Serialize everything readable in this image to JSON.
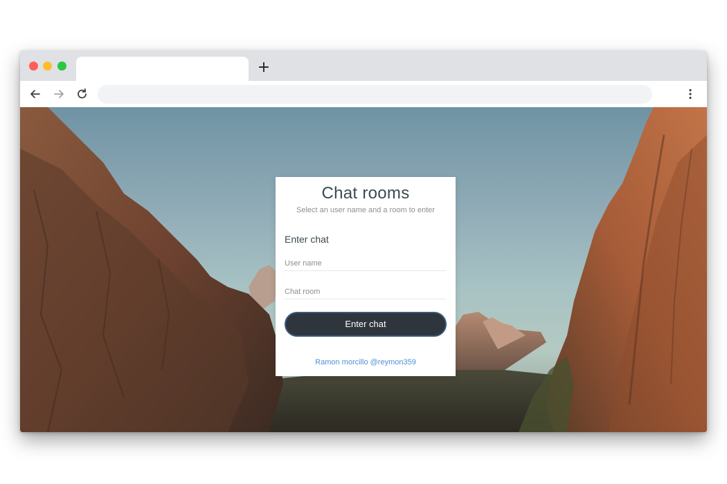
{
  "browser": {
    "new_tab_label": "+",
    "colors": {
      "close": "#ff5f57",
      "minimize": "#febc2e",
      "maximize": "#28c840",
      "tab_strip": "#dfe1e5"
    },
    "icons": [
      "back-arrow-icon",
      "forward-arrow-icon",
      "reload-icon",
      "more-vertical-icon"
    ]
  },
  "card": {
    "title": "Chat rooms",
    "subtitle": "Select an user name and a room to enter",
    "form_heading": "Enter chat",
    "username_placeholder": "User name",
    "room_placeholder": "Chat room",
    "submit_label": "Enter chat",
    "author_link": "Ramon morcillo @reymon359",
    "colors": {
      "button": "#2f353d",
      "link": "#4a90d9"
    }
  }
}
